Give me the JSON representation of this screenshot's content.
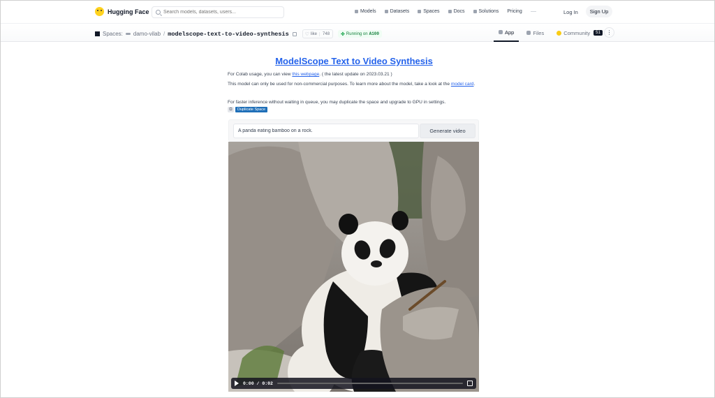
{
  "nav": {
    "brand": "Hugging Face",
    "search_placeholder": "Search models, datasets, users...",
    "links": [
      "Models",
      "Datasets",
      "Spaces",
      "Docs",
      "Solutions",
      "Pricing"
    ],
    "login": "Log In",
    "signup": "Sign Up"
  },
  "space": {
    "spaces_label": "Spaces:",
    "org": "damo-vilab",
    "repo": "modelscope-text-to-video-synthesis",
    "like_label": "like",
    "like_count": "748",
    "status_prefix": "Running on",
    "status_hw": "A100",
    "tabs": {
      "app": "App",
      "files": "Files",
      "community": "Community",
      "community_count": "51"
    },
    "more": "⋮"
  },
  "content": {
    "title": "ModelScope Text to Video Synthesis",
    "p1_before": "For Colab usage, you can view ",
    "p1_link": "this webpage",
    "p1_after": ". ( the latest update on 2023.03.21 )",
    "p2_before": "This model can only be used for non-commercial purposes. To learn more about the model, take a look at the ",
    "p2_link": "model card",
    "p2_after": ".",
    "p3": "For faster inference without waiting in queue, you may duplicate the space and upgrade to GPU in settings.",
    "duplicate_label": "Duplicate Space",
    "prompt_value": "A panda eating bamboo on a rock.",
    "generate_label": "Generate video"
  },
  "video": {
    "current_time": "0:00",
    "duration": "0:02",
    "time_separator": "/",
    "progress": 0
  },
  "colors": {
    "link_blue": "#2563eb",
    "duplicate_badge": "#1f6fb8",
    "running_green": "#15803d",
    "brand_yellow": "#ffd21e"
  }
}
